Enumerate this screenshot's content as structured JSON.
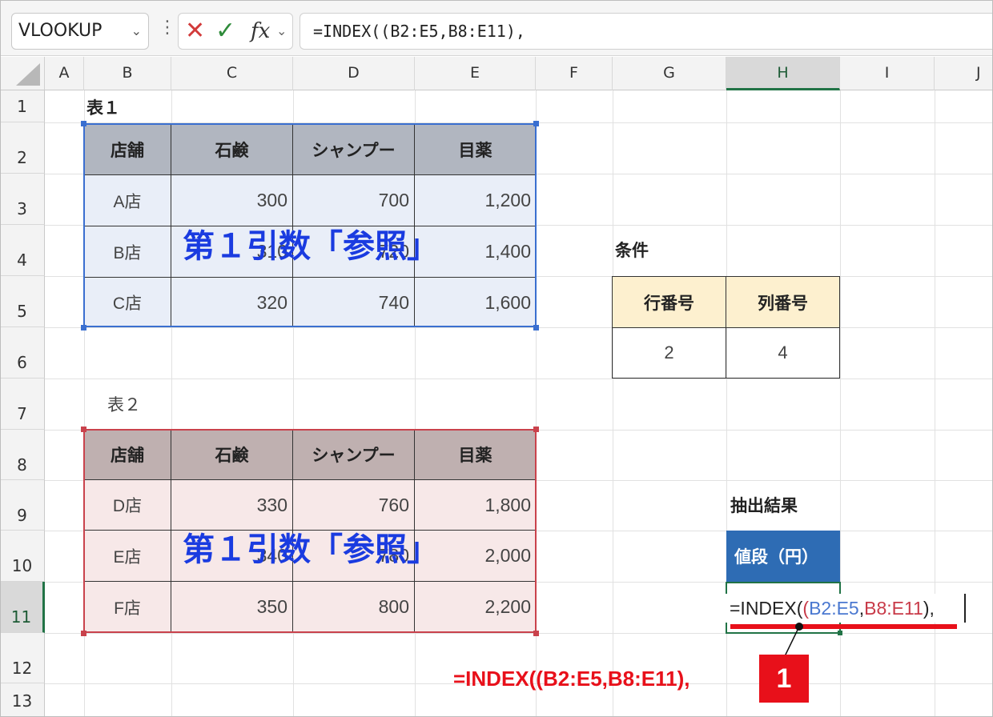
{
  "formula_bar": {
    "name_box": "VLOOKUP",
    "formula": "=INDEX((B2:E5,B8:E11),",
    "cancel_icon": "x-icon",
    "enter_icon": "check-icon",
    "fx_label": "fx"
  },
  "columns": [
    "A",
    "B",
    "C",
    "D",
    "E",
    "F",
    "G",
    "H",
    "I",
    "J"
  ],
  "rows": [
    "1",
    "2",
    "3",
    "4",
    "5",
    "6",
    "7",
    "8",
    "9",
    "10",
    "11",
    "12",
    "13"
  ],
  "table1": {
    "title": "表１",
    "headers": [
      "店舗",
      "石鹸",
      "シャンプー",
      "目薬"
    ],
    "rows": [
      [
        "A店",
        "300",
        "700",
        "1,200"
      ],
      [
        "B店",
        "310",
        "720",
        "1,400"
      ],
      [
        "C店",
        "320",
        "740",
        "1,600"
      ]
    ],
    "overlay": "第１引数「参照」"
  },
  "table2": {
    "title": "表２",
    "headers": [
      "店舗",
      "石鹸",
      "シャンプー",
      "目薬"
    ],
    "rows": [
      [
        "D店",
        "330",
        "760",
        "1,800"
      ],
      [
        "E店",
        "340",
        "780",
        "2,000"
      ],
      [
        "F店",
        "350",
        "800",
        "2,200"
      ]
    ],
    "overlay": "第１引数「参照」"
  },
  "conditions": {
    "title": "条件",
    "headers": [
      "行番号",
      "列番号"
    ],
    "values": [
      "2",
      "4"
    ]
  },
  "result": {
    "title": "抽出結果",
    "header": "値段（円）",
    "formula_prefix": "=INDEX(",
    "formula_open": "(",
    "formula_ref1": "B2:E5",
    "formula_comma": ",",
    "formula_ref2": "B8:E11",
    "formula_close": "),",
    "annotation_text": "=INDEX((B2:E5,B8:E11),",
    "annotation_badge": "1"
  },
  "colors": {
    "table1_border": "#3a6fd0",
    "table1_fill": "#e9eef8",
    "table1_header": "#b1b6c0",
    "table2_border": "#c9424c",
    "table2_fill": "#f7e8e8",
    "table2_header": "#bfb0b0",
    "cond_header": "#fdf0cf",
    "result_header": "#2e6cb4",
    "annotation": "#e8101a",
    "ref1": "#4a78d0",
    "ref2": "#c83a48"
  }
}
